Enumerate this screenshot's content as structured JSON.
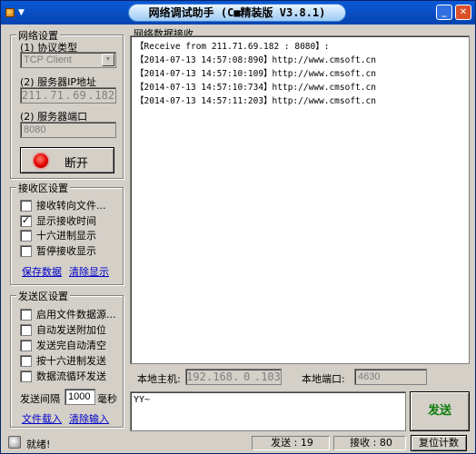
{
  "window": {
    "title": "网络调试助手 (C■精装版 V3.8.1)"
  },
  "net_settings": {
    "title": "网络设置",
    "protocol_label": "(1) 协议类型",
    "protocol_value": "TCP Client",
    "server_ip_label": "(2) 服务器IP地址",
    "server_ip": [
      "211",
      "71",
      "69",
      "182"
    ],
    "server_port_label": "(2) 服务器端口",
    "server_port": "8080",
    "connect_button": "断开"
  },
  "recv_settings": {
    "title": "接收区设置",
    "options": [
      {
        "label": "接收转向文件...",
        "checked": ""
      },
      {
        "label": "显示接收时间",
        "checked": "✓"
      },
      {
        "label": "十六进制显示",
        "checked": ""
      },
      {
        "label": "暂停接收显示",
        "checked": ""
      }
    ],
    "save_link": "保存数据",
    "clear_link": "清除显示"
  },
  "send_settings": {
    "title": "发送区设置",
    "options": [
      {
        "label": "启用文件数据源...",
        "checked": ""
      },
      {
        "label": "自动发送附加位",
        "checked": ""
      },
      {
        "label": "发送完自动清空",
        "checked": ""
      },
      {
        "label": "按十六进制发送",
        "checked": ""
      },
      {
        "label": "数据流循环发送",
        "checked": ""
      }
    ],
    "interval_label": "发送间隔",
    "interval_value": "1000",
    "interval_unit": "毫秒",
    "load_file_link": "文件载入",
    "clear_input_link": "清除输入"
  },
  "recv_area": {
    "title": "网络数据接收",
    "lines": [
      "【Receive from 211.71.69.182 : 8080】:",
      "【2014-07-13 14:57:08:890】http://www.cmsoft.cn",
      "【2014-07-13 14:57:10:109】http://www.cmsoft.cn",
      "【2014-07-13 14:57:10:734】http://www.cmsoft.cn",
      "【2014-07-13 14:57:11:203】http://www.cmsoft.cn"
    ]
  },
  "local": {
    "host_label": "本地主机:",
    "host_ip": [
      "192",
      "168",
      "0",
      "103"
    ],
    "port_label": "本地端口:",
    "port_value": "4630"
  },
  "send_area": {
    "text": "YY~",
    "send_button": "发送"
  },
  "status": {
    "ready": "就绪!",
    "sent": "发送 : 19",
    "received": "接收 : 80",
    "reset_button": "复位计数"
  }
}
